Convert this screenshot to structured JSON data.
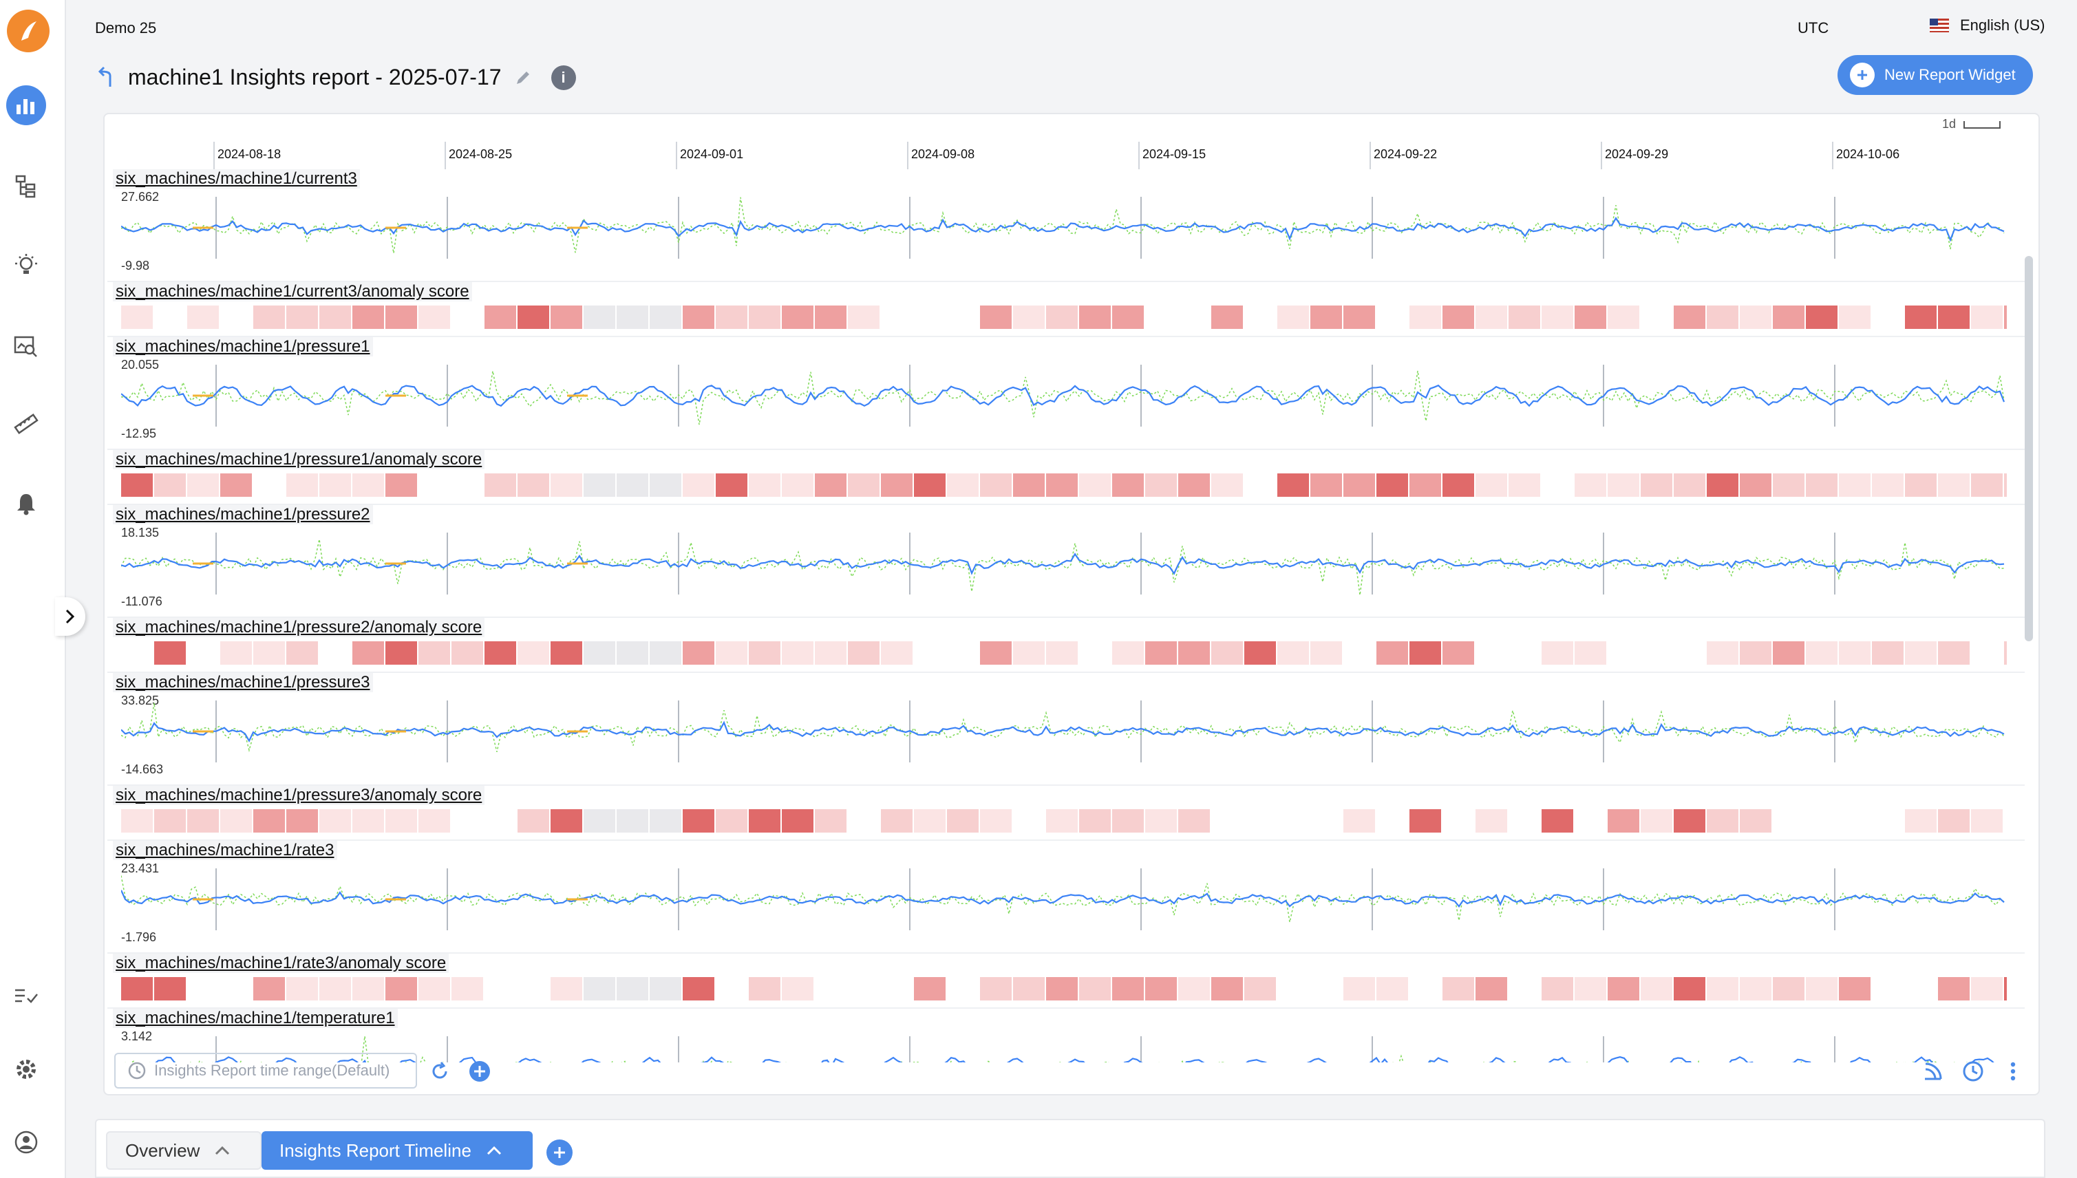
{
  "app": {
    "workspace": "Demo 25",
    "timezone": "UTC",
    "language": "English (US)"
  },
  "header": {
    "title": "machine1 Insights report - 2025-07-17",
    "new_widget_label": "New Report Widget"
  },
  "timeline": {
    "ticks": [
      "2024-08-18",
      "2024-08-25",
      "2024-09-01",
      "2024-09-08",
      "2024-09-15",
      "2024-09-22",
      "2024-09-29",
      "2024-10-06"
    ],
    "scale_label": "1d"
  },
  "rows": [
    {
      "label": "six_machines/machine1/current3",
      "type": "series",
      "max": "27.662",
      "min": "-9.98"
    },
    {
      "label": "six_machines/machine1/current3/anomaly score",
      "type": "anomaly"
    },
    {
      "label": "six_machines/machine1/pressure1",
      "type": "series",
      "max": "20.055",
      "min": "-12.95"
    },
    {
      "label": "six_machines/machine1/pressure1/anomaly score",
      "type": "anomaly"
    },
    {
      "label": "six_machines/machine1/pressure2",
      "type": "series",
      "max": "18.135",
      "min": "-11.076"
    },
    {
      "label": "six_machines/machine1/pressure2/anomaly score",
      "type": "anomaly"
    },
    {
      "label": "six_machines/machine1/pressure3",
      "type": "series",
      "max": "33.825",
      "min": "-14.663"
    },
    {
      "label": "six_machines/machine1/pressure3/anomaly score",
      "type": "anomaly"
    },
    {
      "label": "six_machines/machine1/rate3",
      "type": "series",
      "max": "23.431",
      "min": "-1.796"
    },
    {
      "label": "six_machines/machine1/rate3/anomaly score",
      "type": "anomaly"
    },
    {
      "label": "six_machines/machine1/temperature1",
      "type": "series",
      "max": "3.142",
      "min": ""
    }
  ],
  "controls": {
    "time_range_placeholder": "Insights Report time range(Default)"
  },
  "tabs": [
    {
      "label": "Overview",
      "active": false
    },
    {
      "label": "Insights Report Timeline",
      "active": true
    }
  ],
  "colors": {
    "accent": "#4a8ae8",
    "line_primary": "#3b82f6",
    "line_secondary": "#7ed957",
    "line_gap": "#f2b233",
    "anomaly_high": "#e05a5a"
  },
  "icons": [
    "logo-icon",
    "chart-icon",
    "tree-icon",
    "lightbulb-icon",
    "search-chart-icon",
    "ruler-icon",
    "bell-icon",
    "checklist-icon",
    "gear-icon",
    "user-icon",
    "help-icon",
    "edit-icon",
    "info-icon",
    "clock-icon",
    "refresh-icon",
    "add-icon",
    "rss-icon",
    "more-icon",
    "chevron-up-icon",
    "chevron-right-icon",
    "flag-us-icon"
  ]
}
